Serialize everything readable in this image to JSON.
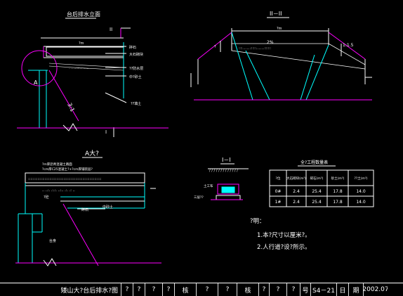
{
  "colors": {
    "background": "#000000",
    "line_white": "#ffffff",
    "cyan": "#00ffff",
    "magenta": "#ff00ff",
    "yellow": "#ffff00",
    "green": "#00ff00"
  },
  "views": {
    "elevation": {
      "title": "台后排水立面",
      "cut_top": "II",
      "cut_bottom": "I",
      "dim_top": "?m",
      "label_a": "A",
      "slope": "3:1",
      "labels": [
        "碎石",
        "大石砌块",
        "??防水层",
        "中?砂土",
        "??填土"
      ]
    },
    "section": {
      "title": "II－II",
      "dim_top": "?m",
      "dim_mid": "2%",
      "slope": "1:1.5",
      "left_label": "?"
    },
    "detail_a": {
      "title": "A大?",
      "top_labels": [
        "?m厚沥青混凝土路面",
        "?cm厚C25混凝土?+?cm厚铺装层?"
      ],
      "labels": [
        "?砼",
        "碎石",
        "中砂土",
        "台身"
      ]
    },
    "section_i": {
      "title": "I－I",
      "labels": [
        "土工布",
        "三层??"
      ]
    },
    "table": {
      "title": "全?工程数量表",
      "headers": [
        "?位",
        "大石砌块(m³)",
        "碎石(m³)",
        "砂土(m³)",
        "??土(m³)"
      ],
      "rows": [
        [
          "0#",
          "2.4",
          "25.4",
          "17.8",
          "14.0"
        ],
        [
          "1#",
          "2.4",
          "25.4",
          "17.8",
          "14.0"
        ]
      ]
    }
  },
  "notes": {
    "heading": "?明：",
    "items": [
      "1.本?尺寸以厘米?。",
      "2.人行道?设?所示。"
    ]
  },
  "title_block": {
    "project": "矮山大?台后排水?图",
    "c1": "?",
    "c2": "?",
    "c3": "?",
    "c4": "?",
    "c5": "核",
    "c6": "?",
    "c7": "?",
    "c8": "核",
    "c9": "?",
    "c10": "?",
    "c11": "?",
    "c12": "号",
    "sheet": "S4－21",
    "c13": "日",
    "c14": "期",
    "date": "2002.07"
  }
}
